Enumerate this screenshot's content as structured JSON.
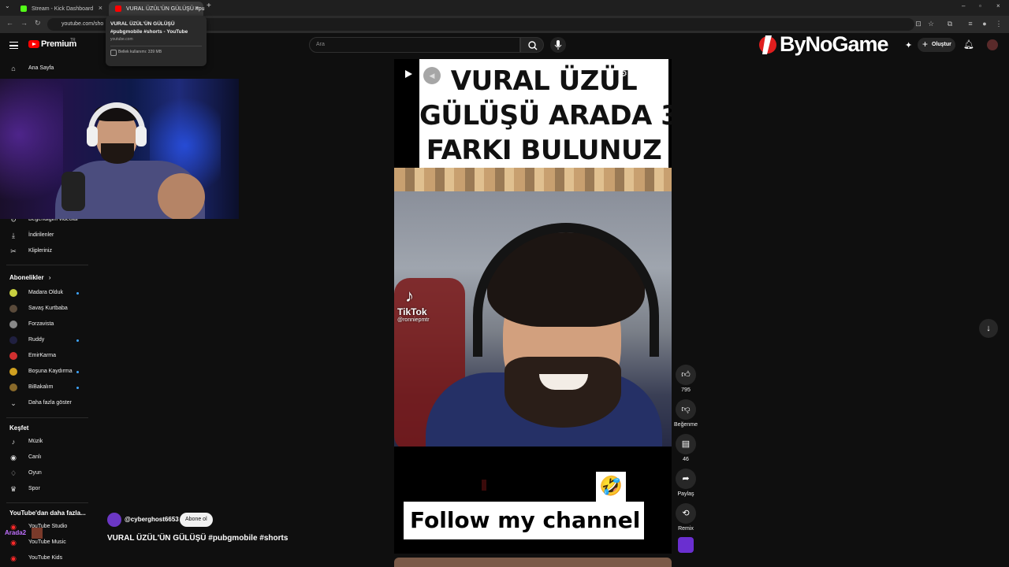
{
  "browser": {
    "tabs": [
      {
        "label": "Stream - Kick Dashboard",
        "icon": "kick-icon",
        "color": "#53fc18"
      },
      {
        "label": "VURAL ÜZÜL'ÜN GÜLÜŞÜ #pu",
        "icon": "youtube-icon",
        "color": "#ff0000"
      }
    ],
    "address": "youtube.com/sho",
    "tooltip": {
      "title_line1": "VURAL ÜZÜL'ÜN GÜLÜŞÜ",
      "title_line2": "#pubgmobile #shorts - YouTube",
      "domain": "youtube.com",
      "memory": "Bellek kullanımı: 339 MB"
    }
  },
  "header": {
    "logo_text": "Premium",
    "country_code": "TR",
    "search_placeholder": "Ara",
    "create_label": "Oluştur",
    "overlay_brand": "ByNoGame"
  },
  "sidebar": {
    "top": [
      {
        "label": "Ana Sayfa",
        "icon": "home-icon"
      }
    ],
    "you": [
      {
        "label": "Beğendiğim videolar",
        "icon": "like-icon"
      },
      {
        "label": "İndirilenler",
        "icon": "download-icon"
      },
      {
        "label": "Klipleriniz",
        "icon": "scissors-icon"
      }
    ],
    "subs_title": "Abonelikler",
    "subs": [
      {
        "label": "Madara Olduk",
        "color": "#c8d040",
        "dot": true
      },
      {
        "label": "Savaş Kurtbaba",
        "color": "#5a4a3a",
        "dot": false
      },
      {
        "label": "Forzavista",
        "color": "#888888",
        "dot": false
      },
      {
        "label": "Ruddy",
        "color": "#202040",
        "dot": true
      },
      {
        "label": "EmirKarma",
        "color": "#d03030",
        "dot": false
      },
      {
        "label": "Boşuna Kaydırma",
        "color": "#d0a020",
        "dot": true
      },
      {
        "label": "BiBakalım",
        "color": "#8a6a2a",
        "dot": true
      }
    ],
    "show_more": "Daha fazla göster",
    "explore_title": "Keşfet",
    "explore": [
      {
        "label": "Müzik",
        "icon": "music-icon"
      },
      {
        "label": "Canlı",
        "icon": "live-icon"
      },
      {
        "label": "Oyun",
        "icon": "gamepad-icon"
      },
      {
        "label": "Spor",
        "icon": "trophy-icon"
      }
    ],
    "more_title": "YouTube'dan daha fazla...",
    "more": [
      {
        "label": "YouTube Studio"
      },
      {
        "label": "YouTube Music"
      },
      {
        "label": "YouTube Kids"
      }
    ]
  },
  "overlay": {
    "arada_label": "Arada2"
  },
  "short": {
    "caption_lines": [
      "VURAL ÜZÜL",
      "GÜLÜŞÜ ARADA 3",
      "FARKI BULUNUZ"
    ],
    "tiktok_label": "TikTok",
    "tiktok_user": "@ronniepmtr",
    "follow_text": "Follow my channel",
    "emoji": "🤣"
  },
  "actions": {
    "likes": "795",
    "dislike_label": "Beğenme",
    "comments": "46",
    "share_label": "Paylaş",
    "remix_label": "Remix"
  },
  "meta": {
    "channel": "@cyberghost6653",
    "subscribe_label": "Abone ol",
    "title": "VURAL ÜZÜL'ÜN GÜLÜŞÜ #pubgmobile #shorts"
  }
}
